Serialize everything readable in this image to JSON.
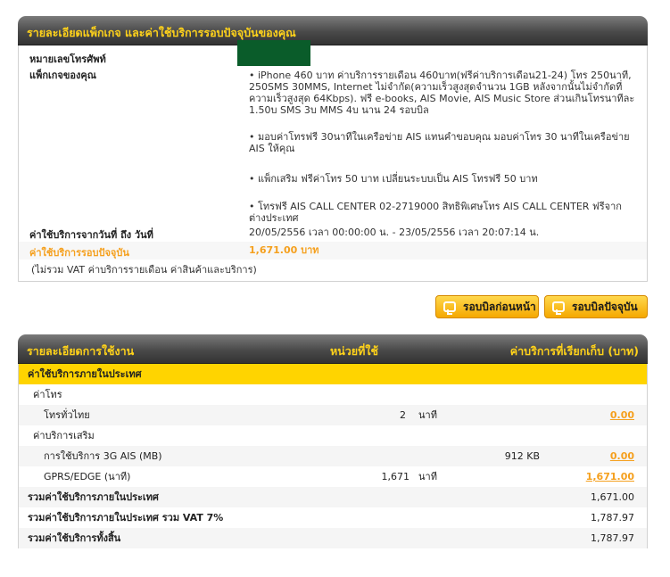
{
  "package_section": {
    "title": "รายละเอียดแพ็กเกจ และค่าใช้บริการรอบปัจจุบันของคุณ",
    "phone_label": "หมายเลขโทรศัพท์",
    "package_label": "แพ็กเกจของคุณ",
    "package_items": [
      "• iPhone 460 บาท ค่าบริการรายเดือน 460บาท(ฟรีค่าบริการเดือน21-24) โทร 250นาที, 250SMS 30MMS, Internet ไม่จำกัด(ความเร็วสูงสุดจำนวน 1GB หลังจากนั้นไม่จำกัดที่ความเร็วสูงสุด 64Kbps). ฟรี e-books, AIS Movie, AIS Music Store ส่วนเกินโทรนาทีละ 1.50บ SMS 3บ MMS 4บ นาน 24 รอบบิล",
      "• มอบค่าโทรฟรี 30นาทีในเครือข่าย AIS แทนคำขอบคุณ มอบค่าโทร 30 นาทีในเครือข่าย AIS ให้คุณ",
      "• แพ็กเสริม ฟรีค่าโทร 50 บาท เปลี่ยนระบบเป็น AIS โทรฟรี 50 บาท",
      "• โทรฟรี AIS CALL CENTER 02-2719000 สิทธิพิเศษโทร AIS CALL CENTER ฟรีจากต่างประเทศ"
    ],
    "period_label": "ค่าใช้บริการจากวันที่ ถึง วันที่",
    "period_value": "20/05/2556 เวลา 00:00:00 น. - 23/05/2556 เวลา 20:07:14 น.",
    "current_label": "ค่าใช้บริการรอบปัจจุบัน",
    "current_value": "1,671.00 บาท",
    "vat_note": "(ไม่รวม VAT ค่าบริการรายเดือน ค่าสินค้าและบริการ)"
  },
  "buttons": {
    "prev_bill": "รอบบิลก่อนหน้า",
    "current_bill": "รอบบิลปัจจุบัน"
  },
  "usage_section": {
    "title": "รายละเอียดการใช้งาน",
    "unit_header": "หน่วยที่ใช้",
    "charge_header": "ค่าบริการที่เรียกเก็บ (บาท)",
    "domestic_header": "ค่าใช้บริการภายในประเทศ",
    "call_group": "ค่าโทร",
    "call_row": {
      "label": "โทรทั่วไทย",
      "qty": "2",
      "unit": "นาที",
      "amount": "0.00"
    },
    "extra_group": "ค่าบริการเสริม",
    "data_row": {
      "label": "การใช้บริการ 3G AIS (MB)",
      "qty": "912 KB",
      "amount": "0.00"
    },
    "gprs_row": {
      "label": "GPRS/EDGE (นาที)",
      "qty": "1,671",
      "unit": "นาที",
      "amount": "1,671.00"
    },
    "total_domestic": {
      "label": "รวมค่าใช้บริการภายในประเทศ",
      "amount": "1,671.00"
    },
    "total_vat": {
      "label": "รวมค่าใช้บริการภายในประเทศ รวม VAT 7%",
      "amount": "1,787.97"
    },
    "grand_total": {
      "label": "รวมค่าใช้บริการทั้งสิ้น",
      "amount": "1,787.97"
    }
  },
  "colors": {
    "accent": "#ffd400",
    "orange": "#f5a01e",
    "masked_box": "#0a5c2a"
  }
}
